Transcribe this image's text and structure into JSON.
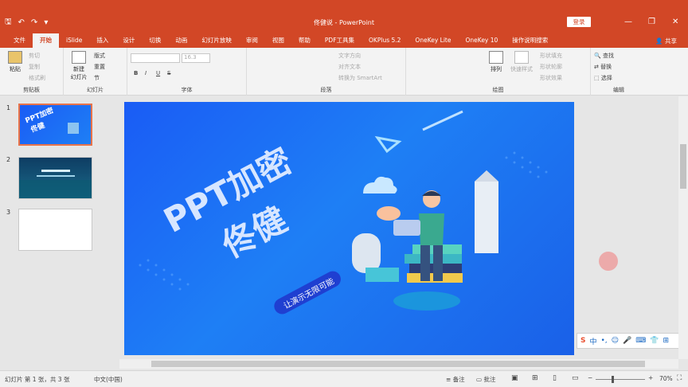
{
  "window": {
    "doc_title": "佟健说 - PowerPoint",
    "login_label": "登录",
    "share_label": "共享",
    "minimize": "—",
    "restore": "❐",
    "close": "✕"
  },
  "qat": {
    "save": "🖫",
    "undo": "↶",
    "redo": "↷",
    "more": "▾"
  },
  "tabs": [
    "文件",
    "开始",
    "iSlide",
    "插入",
    "设计",
    "切换",
    "动画",
    "幻灯片放映",
    "审阅",
    "视图",
    "帮助",
    "PDF工具集",
    "OKPlus 5.2",
    "OneKey Lite",
    "OneKey 10",
    "操作说明搜索"
  ],
  "active_tab_index": 1,
  "ribbon": {
    "clipboard": {
      "paste": "粘贴",
      "cut": "剪切",
      "copy": "复制",
      "format_painter": "格式刷",
      "label": "剪贴板"
    },
    "slides": {
      "new_slide": "新建\n幻灯片",
      "layout": "版式",
      "reset": "重置",
      "section": "节",
      "label": "幻灯片"
    },
    "font": {
      "size": "16.3",
      "bold": "B",
      "italic": "I",
      "underline": "U",
      "strike": "S",
      "label": "字体"
    },
    "paragraph": {
      "text_direction": "文字方向",
      "align_text": "对齐文本",
      "smartart": "转换为 SmartArt",
      "label": "段落"
    },
    "drawing": {
      "arrange": "排列",
      "quick_styles": "快速样式",
      "shape_fill": "形状填充",
      "shape_outline": "形状轮廓",
      "shape_effects": "形状效果",
      "label": "绘图"
    },
    "editing": {
      "find": "查找",
      "replace": "替换",
      "select": "选择",
      "label": "编辑"
    }
  },
  "thumbnails": [
    {
      "num": "1",
      "selected": true
    },
    {
      "num": "2",
      "selected": false
    },
    {
      "num": "3",
      "selected": false
    }
  ],
  "slide": {
    "title_line1": "PPT加密",
    "title_line2": "佟健",
    "tagline": "让演示无限可能"
  },
  "ime": {
    "label": "中"
  },
  "status": {
    "slide_info": "幻灯片 第 1 张，共 3 张",
    "language": "中文(中国)",
    "notes": "备注",
    "comments": "批注",
    "zoom": "70%"
  },
  "colors": {
    "accent": "#d24726",
    "slide_blue": "#1e6ff5"
  }
}
